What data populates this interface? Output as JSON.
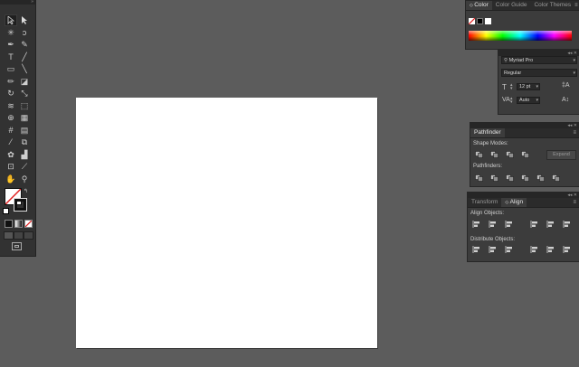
{
  "app": {
    "canvas_bg": "#5c5c5c",
    "panel_bg": "#3c3c3c",
    "accent_active_tab": "#e8e8e8"
  },
  "toolbar": {
    "tools": [
      "selection-tool-icon",
      "direct-selection-tool-icon",
      "magic-wand-tool-icon",
      "lasso-tool-icon",
      "pen-tool-icon",
      "curvature-tool-icon",
      "type-tool-icon",
      "line-segment-tool-icon",
      "rectangle-tool-icon",
      "paintbrush-tool-icon",
      "pencil-tool-icon",
      "eraser-tool-icon",
      "rotate-tool-icon",
      "scale-tool-icon",
      "width-tool-icon",
      "free-transform-tool-icon",
      "shape-builder-tool-icon",
      "perspective-grid-tool-icon",
      "mesh-tool-icon",
      "gradient-tool-icon",
      "eyedropper-tool-icon",
      "blend-tool-icon",
      "symbol-sprayer-tool-icon",
      "column-graph-tool-icon",
      "artboard-tool-icon",
      "slice-tool-icon",
      "hand-tool-icon",
      "zoom-tool-icon"
    ]
  },
  "color_panel": {
    "tabs": [
      "Color",
      "Color Guide",
      "Color Themes"
    ]
  },
  "character_panel": {
    "font_family": "Myriad Pro",
    "font_style": "Regular",
    "font_size": "12 pt",
    "leading": "Auto"
  },
  "pathfinder_panel": {
    "tab": "Pathfinder",
    "shape_modes_label": "Shape Modes:",
    "expand_label": "Expand",
    "pathfinders_label": "Pathfinders:"
  },
  "align_panel": {
    "tabs": [
      "Transform",
      "Align"
    ],
    "align_objects_label": "Align Objects:",
    "distribute_objects_label": "Distribute Objects:"
  }
}
